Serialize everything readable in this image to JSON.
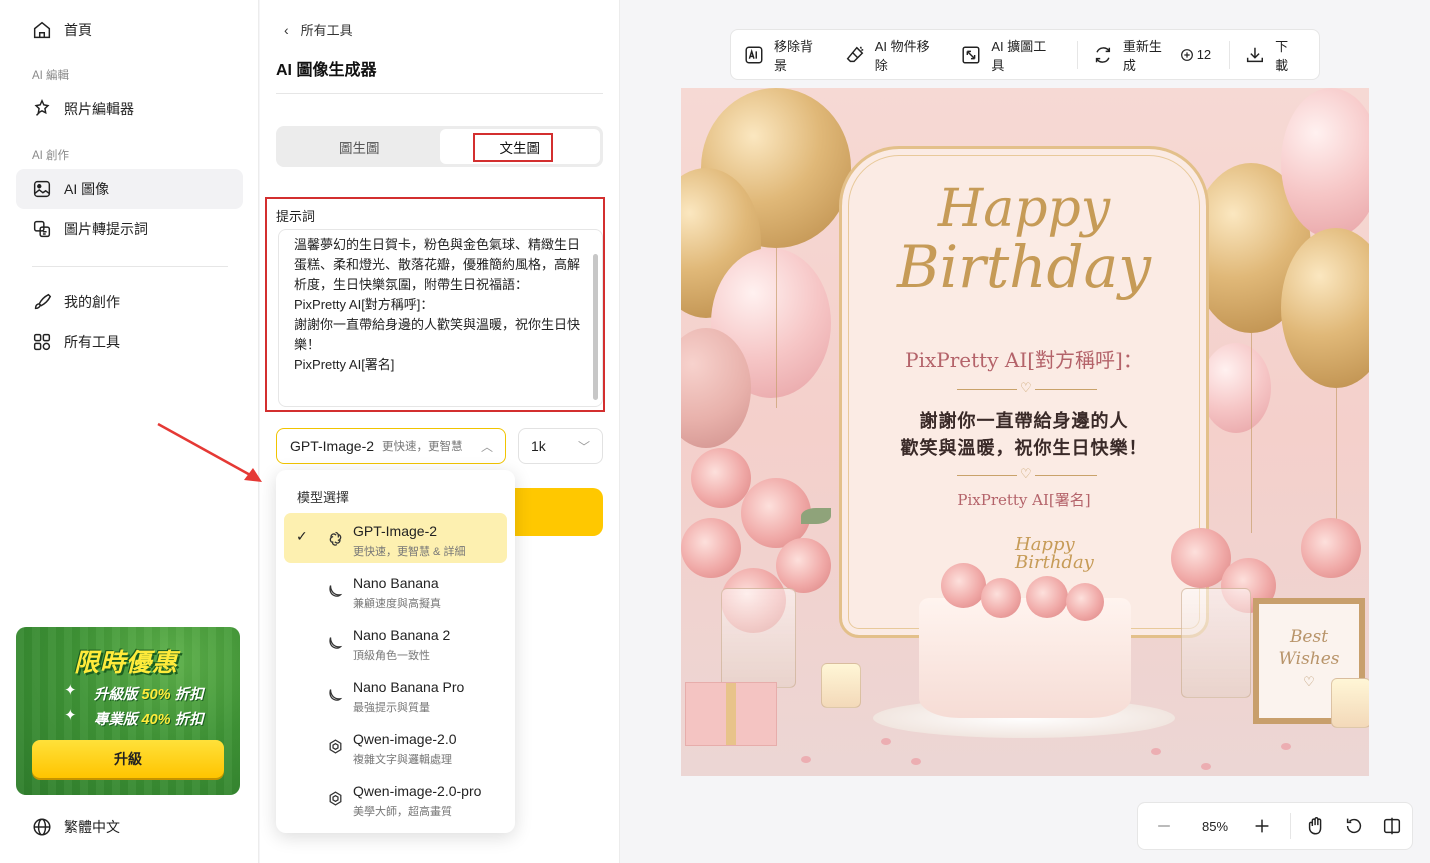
{
  "nav": {
    "home": "首頁",
    "section_edit": "AI 編輯",
    "photo_editor": "照片編輯器",
    "section_create": "AI 創作",
    "ai_image": "AI 圖像",
    "image_to_prompt": "圖片轉提示詞",
    "my_creations": "我的創作",
    "all_tools": "所有工具",
    "language": "繁體中文"
  },
  "promo": {
    "title": "限時優惠",
    "line1_prefix": "升級版 ",
    "line1_discount": "50%",
    "line1_suffix": " 折扣",
    "line2_prefix": "專業版 ",
    "line2_discount": "40%",
    "line2_suffix": " 折扣",
    "button": "升級"
  },
  "panel": {
    "back_label": "所有工具",
    "title": "AI 圖像生成器",
    "tabs": [
      {
        "label": "圖生圖",
        "active": false
      },
      {
        "label": "文生圖",
        "active": true
      }
    ],
    "prompt_label": "提示詞",
    "prompt_text": "溫馨夢幻的生日賀卡，粉色與金色氣球、精緻生日蛋糕、柔和燈光、散落花瓣，優雅簡約風格，高解析度，生日快樂氛圍，附帶生日祝福語：\nPixPretty AI[對方稱呼]：\n謝謝你一直帶給身邊的人歡笑與溫暖，祝你生日快樂！\nPixPretty AI[署名]",
    "model_select": {
      "name": "GPT-Image-2",
      "desc": "更快速，更智慧"
    },
    "resolution": "1k"
  },
  "dropdown": {
    "title": "模型選擇",
    "items": [
      {
        "name": "GPT-Image-2",
        "desc": "更快速，更智慧 & 詳細",
        "selected": true,
        "icon": "openai-icon"
      },
      {
        "name": "Nano Banana",
        "desc": "兼顧速度與高擬真",
        "selected": false,
        "icon": "banana-icon"
      },
      {
        "name": "Nano Banana 2",
        "desc": "頂級角色一致性",
        "selected": false,
        "icon": "banana-icon"
      },
      {
        "name": "Nano Banana Pro",
        "desc": "最強提示與質量",
        "selected": false,
        "icon": "banana-icon"
      },
      {
        "name": "Qwen-image-2.0",
        "desc": "複雜文字與邏輯處理",
        "selected": false,
        "icon": "qwen-icon"
      },
      {
        "name": "Qwen-image-2.0-pro",
        "desc": "美學大師，超高畫質",
        "selected": false,
        "icon": "qwen-icon"
      }
    ]
  },
  "toolbar": {
    "remove_bg": "移除背景",
    "object_remove": "AI 物件移除",
    "expand": "AI 擴圖工具",
    "regenerate": "重新生成",
    "credits": "12",
    "download": "下載"
  },
  "card": {
    "happy": "Happy",
    "birthday": "Birthday",
    "sender": "PixPretty AI[對方稱呼]：",
    "message_line1": "謝謝你一直帶給身邊的人",
    "message_line2": "歡笑與溫暖，祝你生日快樂！",
    "signature": "PixPretty AI[署名]",
    "topper_line1": "Happy",
    "topper_line2": "Birthday",
    "frame_line1": "Best",
    "frame_line2": "Wishes",
    "colors": {
      "gold": "#c69b57",
      "rose": "#b4636a",
      "pink_bg": "#f6d9d4"
    }
  },
  "zoom": {
    "level": "85%"
  },
  "colors": {
    "accent": "#ffc800",
    "highlight_border": "#d32f2f",
    "selected_bg": "#fdf0b0"
  }
}
